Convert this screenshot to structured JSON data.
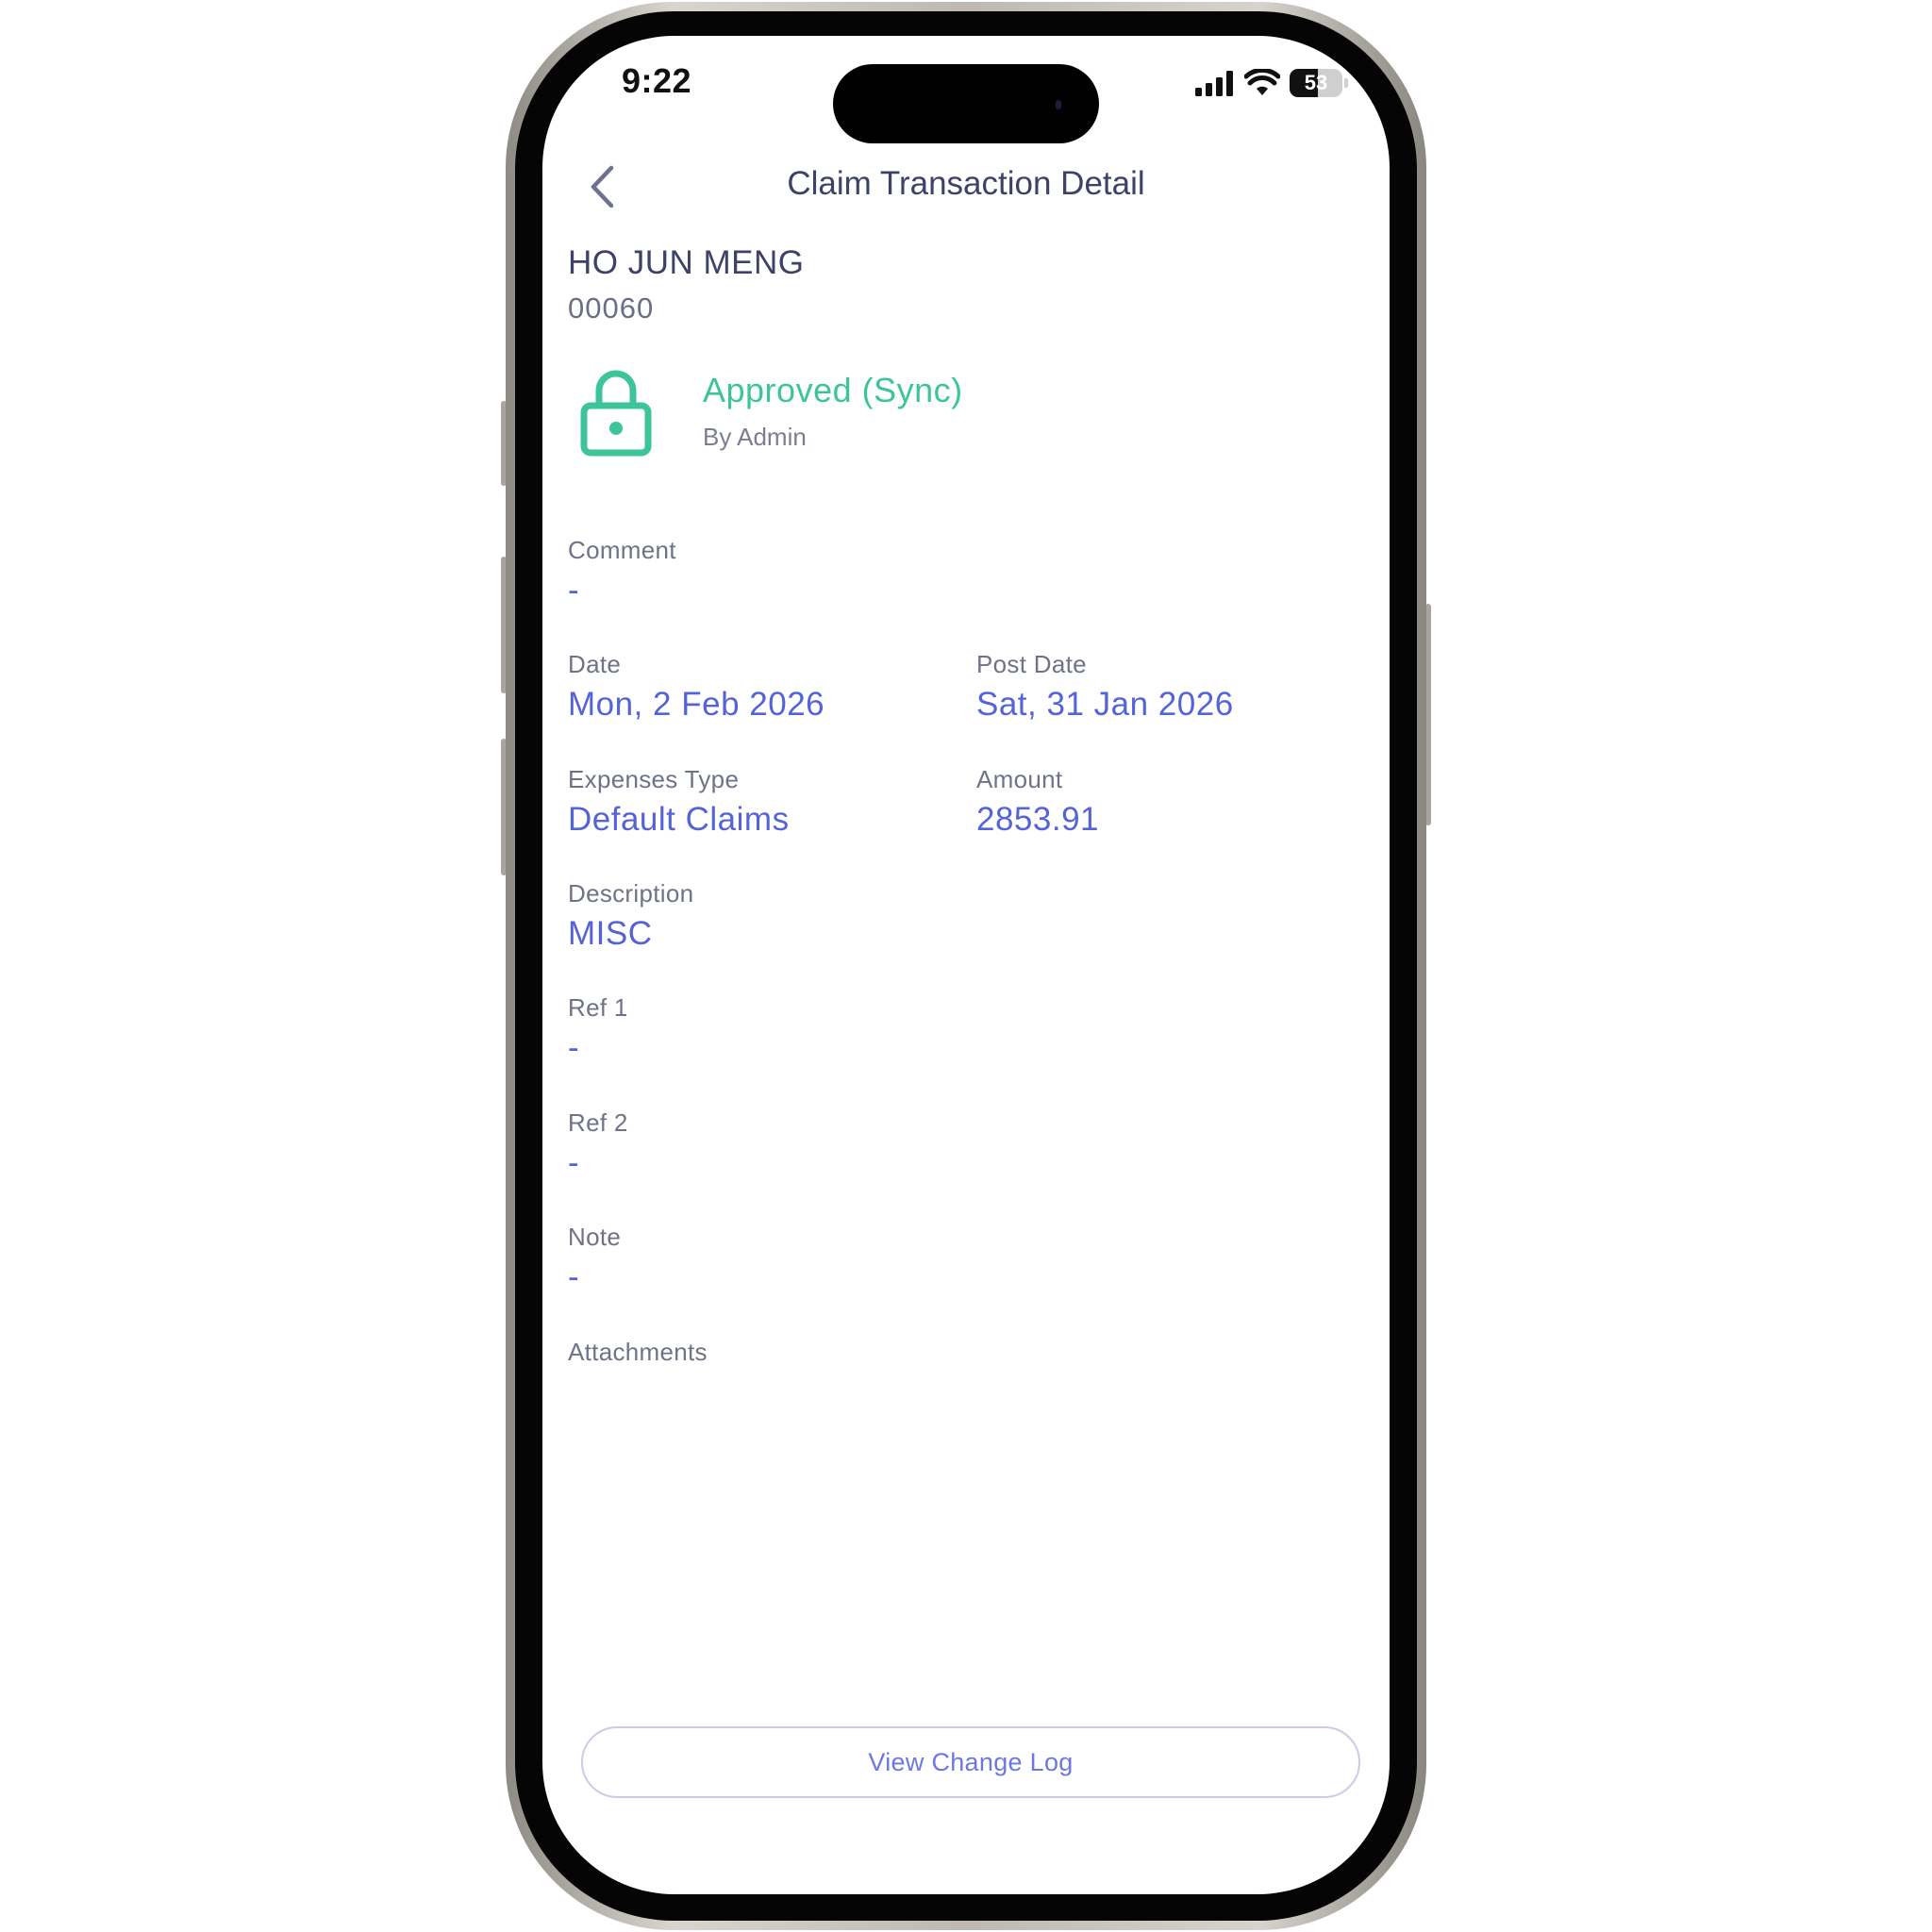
{
  "status_bar": {
    "time": "9:22",
    "battery_level": "53",
    "battery_fraction": 0.53
  },
  "header": {
    "title": "Claim Transaction Detail",
    "back_icon": "chevron-left-icon"
  },
  "employee": {
    "name": "HO JUN MENG",
    "id": "00060"
  },
  "approval": {
    "icon": "lock-icon",
    "status": "Approved (Sync)",
    "by": "By Admin",
    "color": "#3ec49b"
  },
  "fields": {
    "comment": {
      "label": "Comment",
      "value": "-"
    },
    "date": {
      "label": "Date",
      "value": "Mon, 2 Feb 2026"
    },
    "post_date": {
      "label": "Post Date",
      "value": "Sat, 31 Jan 2026"
    },
    "expenses_type": {
      "label": "Expenses Type",
      "value": "Default Claims"
    },
    "amount": {
      "label": "Amount",
      "value": "2853.91"
    },
    "description": {
      "label": "Description",
      "value": "MISC"
    },
    "ref1": {
      "label": "Ref 1",
      "value": "-"
    },
    "ref2": {
      "label": "Ref 2",
      "value": "-"
    },
    "note": {
      "label": "Note",
      "value": "-"
    },
    "attachments": {
      "label": "Attachments"
    }
  },
  "actions": {
    "change_log_label": "View Change Log"
  },
  "colors": {
    "accent": "#5563d8",
    "title_text": "#3d4266",
    "label_text": "#6f7388",
    "approved": "#3ec49b"
  }
}
